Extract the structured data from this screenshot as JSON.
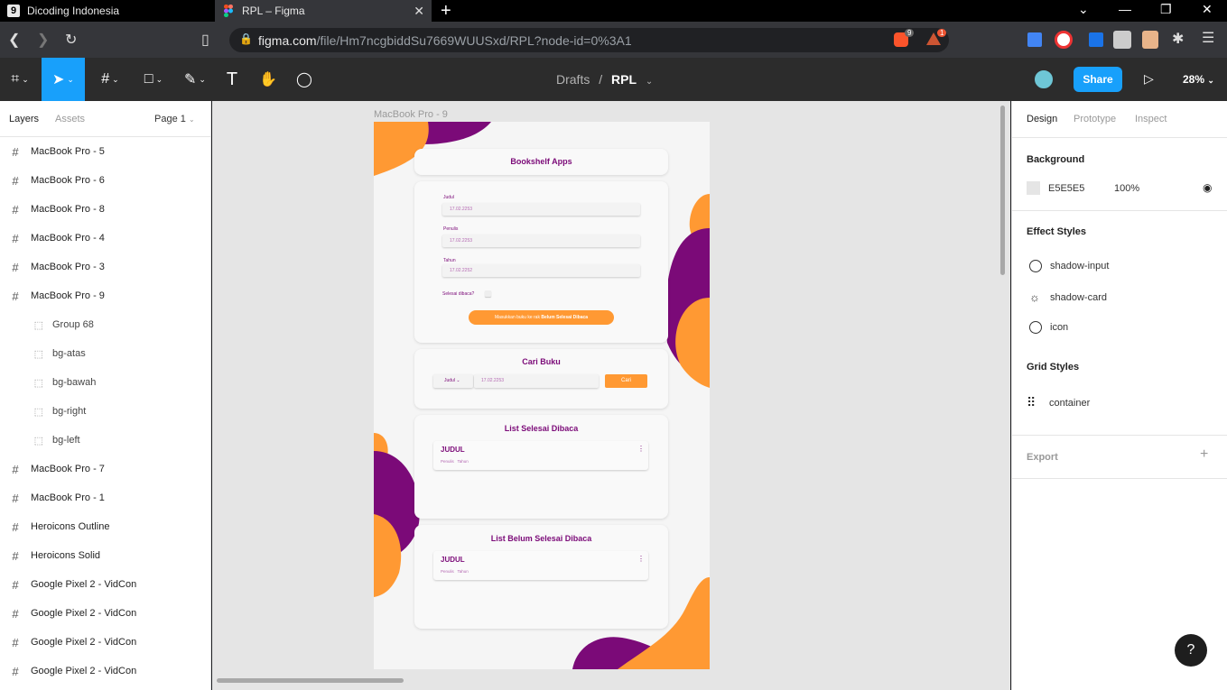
{
  "browser": {
    "tabs": [
      {
        "title": "Dicoding Indonesia",
        "favicon": "d"
      },
      {
        "title": "RPL – Figma",
        "favicon": "figma-icon"
      }
    ],
    "url_host": "figma.com",
    "url_path": "/file/Hm7ncgbiddSu7669WUUSxd/RPL?node-id=0%3A1",
    "brave_badge": "9",
    "alert_badge": "1"
  },
  "toolbar": {
    "breadcrumb_parent": "Drafts",
    "breadcrumb_sep": "/",
    "file_name": "RPL",
    "share_label": "Share",
    "zoom": "28%"
  },
  "left_panel": {
    "tabs": [
      "Layers",
      "Assets"
    ],
    "page_selector": "Page 1",
    "layers": [
      {
        "name": "MacBook Pro - 5",
        "child": false
      },
      {
        "name": "MacBook Pro - 6",
        "child": false
      },
      {
        "name": "MacBook Pro - 8",
        "child": false
      },
      {
        "name": "MacBook Pro - 4",
        "child": false
      },
      {
        "name": "MacBook Pro - 3",
        "child": false
      },
      {
        "name": "MacBook Pro - 9",
        "child": false
      },
      {
        "name": "Group 68",
        "child": true
      },
      {
        "name": "bg-atas",
        "child": true
      },
      {
        "name": "bg-bawah",
        "child": true
      },
      {
        "name": "bg-right",
        "child": true
      },
      {
        "name": "bg-left",
        "child": true
      },
      {
        "name": "MacBook Pro - 7",
        "child": false
      },
      {
        "name": "MacBook Pro - 1",
        "child": false
      },
      {
        "name": "Heroicons Outline",
        "child": false
      },
      {
        "name": "Heroicons Solid",
        "child": false
      },
      {
        "name": "Google Pixel 2 - VidCon",
        "child": false
      },
      {
        "name": "Google Pixel 2 - VidCon",
        "child": false
      },
      {
        "name": "Google Pixel 2 - VidCon",
        "child": false
      },
      {
        "name": "Google Pixel 2 - VidCon",
        "child": false
      }
    ]
  },
  "canvas": {
    "frame_label": "MacBook Pro - 9",
    "app_title": "Bookshelf Apps",
    "form": {
      "title_label": "Judul",
      "title_value": "17.02.2253",
      "author_label": "Penulis",
      "author_value": "17.02.2253",
      "year_label": "Tahun",
      "year_value": "17.02.2252",
      "checkbox_label": "Selesai dibaca?",
      "submit_prefix": "Masukkan buku ke rak",
      "submit_bold": "Belum Selesai Dibaca"
    },
    "search": {
      "title": "Cari Buku",
      "filter_value": "Judul",
      "query": "17.02.2253",
      "button": "Cari"
    },
    "done_list": {
      "title": "List Selesai Dibaca",
      "item_title": "JUDUL",
      "item_author": "Penulis",
      "item_year": "Tahun"
    },
    "undone_list": {
      "title": "List Belum Selesai Dibaca",
      "item_title": "JUDUL",
      "item_author": "Penulis",
      "item_year": "Tahun"
    },
    "colors": {
      "purple": "#7b0a78",
      "orange": "#ff9933",
      "bg": "#f5f5f5"
    }
  },
  "right_panel": {
    "tabs": [
      "Design",
      "Prototype",
      "Inspect"
    ],
    "background_heading": "Background",
    "background_hex": "E5E5E5",
    "background_opacity": "100%",
    "effect_heading": "Effect Styles",
    "effects": [
      "shadow-input",
      "shadow-card",
      "icon"
    ],
    "grid_heading": "Grid Styles",
    "grid_style": "container",
    "export_heading": "Export",
    "help": "?"
  }
}
